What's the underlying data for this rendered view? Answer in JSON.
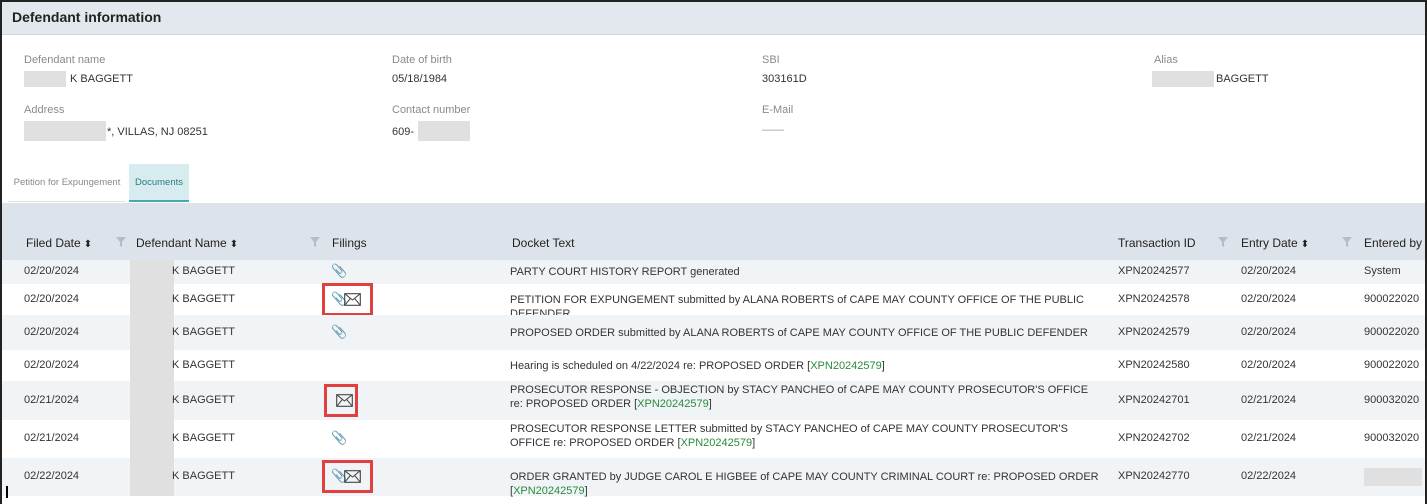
{
  "section": {
    "title": "Defendant information"
  },
  "defendant": {
    "name_label": "Defendant name",
    "name_value": "K BAGGETT",
    "dob_label": "Date of birth",
    "dob_value": "05/18/1984",
    "sbi_label": "SBI",
    "sbi_value": "303161D",
    "alias_label": "Alias",
    "alias_value": "BAGGETT",
    "address_label": "Address",
    "address_value": "*, VILLAS, NJ 08251",
    "contact_label": "Contact number",
    "contact_value": "609-",
    "email_label": "E-Mail",
    "email_value": "——"
  },
  "tabs": [
    {
      "label": "Petition for Expungement",
      "active": false
    },
    {
      "label": "Documents",
      "active": true
    }
  ],
  "table": {
    "columns": [
      "Filed Date",
      "Defendant Name",
      "Filings",
      "Docket Text",
      "Transaction ID",
      "Entry Date",
      "Entered by"
    ],
    "sort_glyph": "⬍",
    "rows": [
      {
        "filed": "02/20/2024",
        "name": "K BAGGETT",
        "clip": true,
        "env": false,
        "highlight": false,
        "docket": "PARTY COURT HISTORY REPORT generated",
        "link": "",
        "txn": "XPN20242577",
        "entry": "02/20/2024",
        "by": "System"
      },
      {
        "filed": "02/20/2024",
        "name": "K BAGGETT",
        "clip": true,
        "env": true,
        "highlight": true,
        "docket": "PETITION FOR EXPUNGEMENT submitted by ALANA ROBERTS of CAPE MAY COUNTY OFFICE OF THE PUBLIC DEFENDER",
        "link": "",
        "txn": "XPN20242578",
        "entry": "02/20/2024",
        "by": "900022020"
      },
      {
        "filed": "02/20/2024",
        "name": "K BAGGETT",
        "clip": true,
        "env": false,
        "highlight": false,
        "docket": "PROPOSED ORDER submitted by ALANA ROBERTS of CAPE MAY COUNTY OFFICE OF THE PUBLIC DEFENDER",
        "link": "",
        "txn": "XPN20242579",
        "entry": "02/20/2024",
        "by": "900022020"
      },
      {
        "filed": "02/20/2024",
        "name": "K BAGGETT",
        "clip": false,
        "env": false,
        "highlight": false,
        "docket": "Hearing is scheduled on 4/22/2024 re: PROPOSED ORDER [",
        "link": "XPN20242579",
        "txn": "XPN20242580",
        "entry": "02/20/2024",
        "by": "900022020"
      },
      {
        "filed": "02/21/2024",
        "name": "K BAGGETT",
        "clip": false,
        "env": true,
        "highlight": true,
        "docket": "PROSECUTOR RESPONSE - OBJECTION by STACY PANCHEO of CAPE MAY COUNTY PROSECUTOR'S OFFICE re: PROPOSED ORDER [",
        "link": "XPN20242579",
        "txn": "XPN20242701",
        "entry": "02/21/2024",
        "by": "900032020"
      },
      {
        "filed": "02/21/2024",
        "name": "K BAGGETT",
        "clip": true,
        "env": false,
        "highlight": false,
        "docket": "PROSECUTOR RESPONSE LETTER submitted by STACY PANCHEO of CAPE MAY COUNTY PROSECUTOR'S OFFICE re: PROPOSED ORDER [",
        "link": "XPN20242579",
        "txn": "XPN20242702",
        "entry": "02/21/2024",
        "by": "900032020"
      },
      {
        "filed": "02/22/2024",
        "name": "K BAGGETT",
        "clip": true,
        "env": true,
        "highlight": true,
        "docket": "ORDER GRANTED by JUDGE CAROL E HIGBEE of CAPE MAY COUNTY CRIMINAL COURT re: PROPOSED ORDER [",
        "link": "XPN20242579",
        "txn": "XPN20242770",
        "entry": "02/22/2024",
        "by": ""
      }
    ]
  },
  "icons": {
    "clip": "📎",
    "clip_icon": "paperclip-icon",
    "env_icon": "envelope-icon",
    "filter_icon": "filter-icon"
  },
  "colors": {
    "highlight": "#e04040",
    "link": "#2a8a3a",
    "active_tab": "#2a7a85"
  }
}
